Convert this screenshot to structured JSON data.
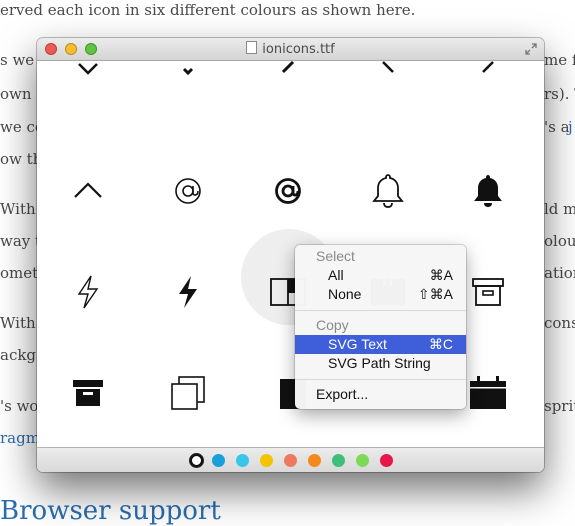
{
  "article": {
    "line1": "erved each icon in six different colours as shown here.",
    "left_fragments": [
      "s we",
      "own",
      "we cou",
      "ow th",
      "With t",
      "way t",
      "omet",
      "With t",
      "ackg",
      "'s wo",
      "ragm"
    ],
    "right_fragments": [
      "me f",
      "rs). T",
      "'s a",
      "j",
      "ld m",
      "olou",
      "ation",
      "cons",
      "sprit"
    ],
    "heading": "Browser support"
  },
  "window": {
    "title": "ionicons.ttf"
  },
  "palette": {
    "colors": [
      "#111111",
      "#1aa0d8",
      "#38c6e8",
      "#f5c400",
      "#f07860",
      "#f48a1e",
      "#3fbf7a",
      "#7ed957",
      "#e8174a"
    ],
    "selected_index": 0
  },
  "context_menu": {
    "select_header": "Select",
    "all_label": "All",
    "all_shortcut": "⌘A",
    "none_label": "None",
    "none_shortcut": "⇧⌘A",
    "copy_header": "Copy",
    "svg_text_label": "SVG Text",
    "svg_text_shortcut": "⌘C",
    "svg_path_label": "SVG Path String",
    "export_label": "Export..."
  }
}
